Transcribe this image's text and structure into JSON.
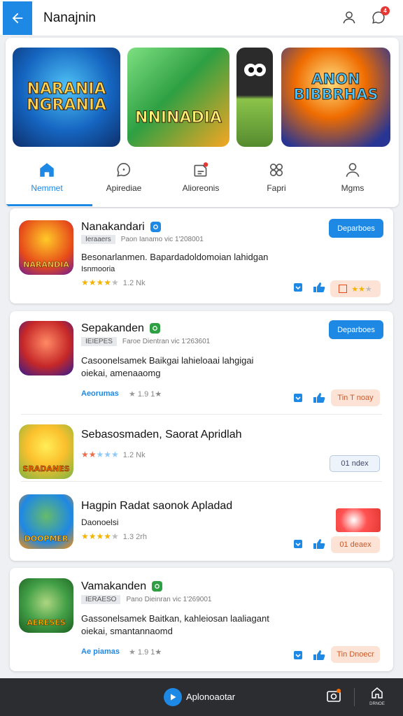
{
  "header": {
    "title": "Nanajnin",
    "notification_count": "4"
  },
  "banners": [
    {
      "text": "NARANIA NGRANIA",
      "colors": [
        "#2a7fd6",
        "#0d2f6b"
      ]
    },
    {
      "text": "NNINADIA",
      "colors": [
        "#39c16b",
        "#f6a623"
      ]
    },
    {
      "text": "",
      "colors": [
        "#1a1a1a",
        "#7ac943"
      ]
    },
    {
      "text": "ANON BIBBRHAS",
      "colors": [
        "#e65c2c",
        "#2d3f8f"
      ]
    }
  ],
  "categories": [
    {
      "label": "Nemmet",
      "icon": "home-icon",
      "active": true
    },
    {
      "label": "Apirediae",
      "icon": "chat-icon",
      "active": false
    },
    {
      "label": "Alioreonis",
      "icon": "notification-icon",
      "active": false
    },
    {
      "label": "Fapri",
      "icon": "grid-icon",
      "active": false
    },
    {
      "label": "Mgms",
      "icon": "user-icon",
      "active": false
    }
  ],
  "apps": [
    {
      "name": "Nanakandari",
      "tag": "Ieraaers",
      "meta": "Paon Ianamo vic 1'208001",
      "desc1": "Besonarlanmen. Bapardadoldomoian lahidgan",
      "desc2": "Isnmooria",
      "rating_count": "1.2 Nk",
      "action": "Deparboes",
      "icon_word": "NARANDIA",
      "icon_colors": [
        "#ffb300",
        "#c62828"
      ]
    },
    {
      "name": "Sepakanden",
      "tag": "IEIEPES",
      "meta": "Faroe Dientran vic 1'263601",
      "desc1": "Casoonelsamek Baikgai lahieloaai lahgigai",
      "desc2": "oiekai, amenaaomg",
      "link": "Aeorumas",
      "rating_count": "1.9 1★",
      "action": "Deparboes",
      "peach_label": "Tin T noay",
      "icon_word": "",
      "icon_colors": [
        "#3f51b5",
        "#8e24aa"
      ]
    },
    {
      "name": "Sebasosmaden, Saorat Apridlah",
      "rating_count": "1.2 Nk",
      "outline_label": "01 ndex",
      "icon_word": "SRADANES",
      "icon_colors": [
        "#ffd600",
        "#7cb342"
      ]
    },
    {
      "name": "Hagpin Radat saonok Apladad",
      "desc1": "Daonoelsi",
      "rating_count": "1.3 2rh",
      "peach_label": "01 deaex",
      "icon_word": "DOOPMER",
      "icon_colors": [
        "#3949ab",
        "#ff8f00"
      ]
    },
    {
      "name": "Vamakanden",
      "tag": "IERAESO",
      "meta": "Pano Dieinran vic 1'269001",
      "desc1": "Gassonelsamek Baitkan, kahleiosan laaliagant",
      "desc2": "oiekai, smantannaomd",
      "link": "Ae piamas",
      "rating_count": "1.9 1★",
      "peach_label": "Tin Dnoecr",
      "icon_word": "AERESES",
      "icon_colors": [
        "#43a047",
        "#1b5e20"
      ]
    }
  ],
  "bottom_bar": {
    "label": "Aplonoaotar",
    "right_label": "DRNOE"
  }
}
